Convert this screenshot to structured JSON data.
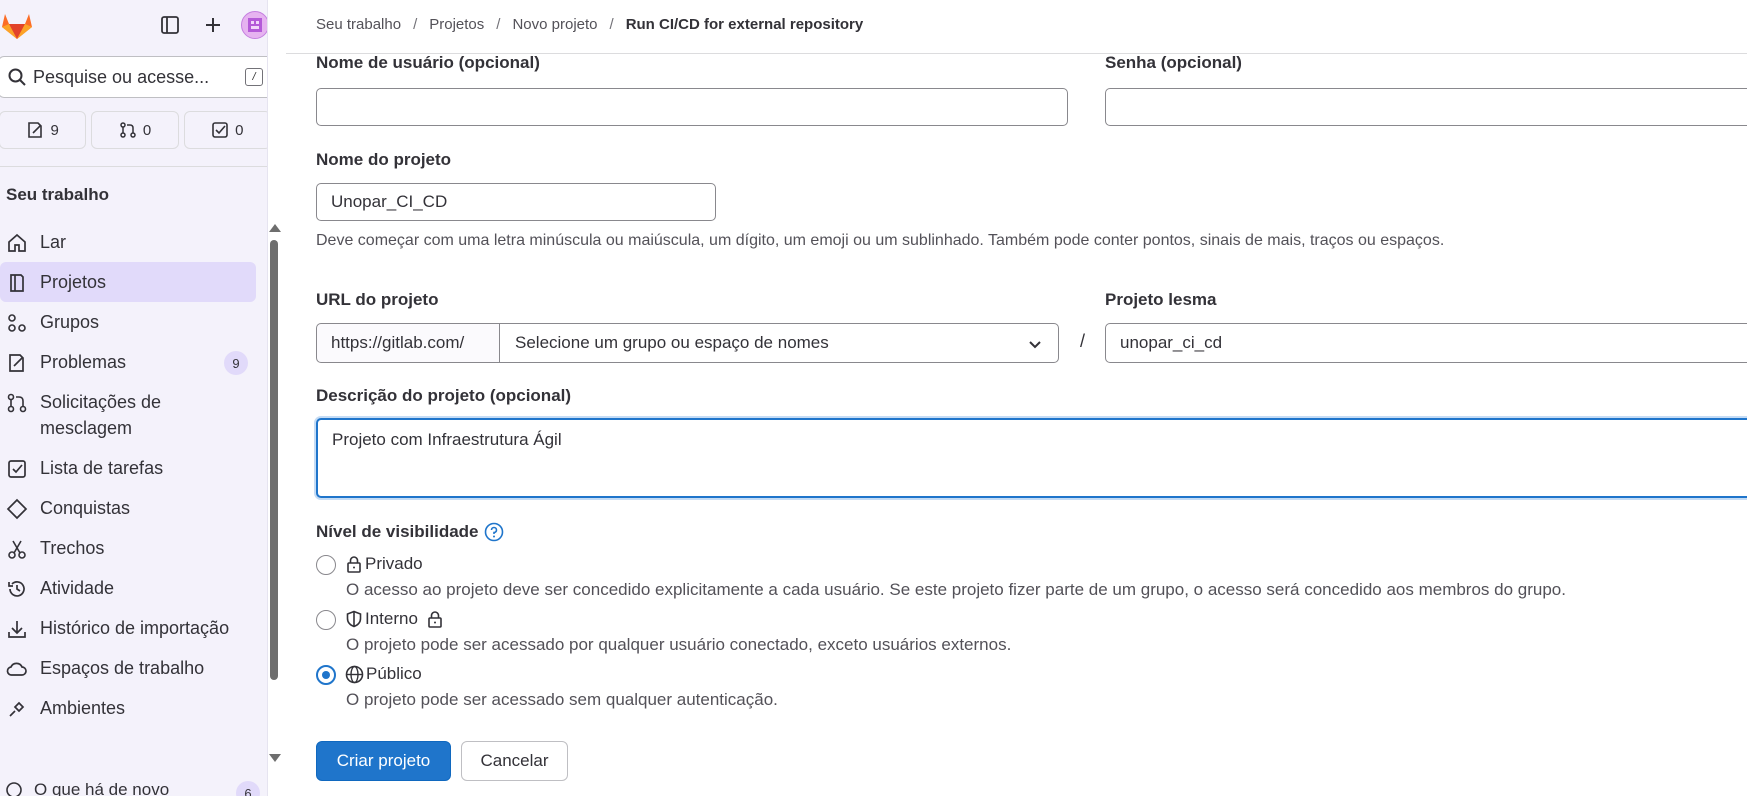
{
  "colors": {
    "accent": "#1f75cb",
    "sidebar_bg": "#f4f2fb",
    "active_nav": "#e1dafa",
    "logo_orange": "#e24329"
  },
  "sidebar": {
    "search_placeholder": "Pesquise ou acesse...",
    "search_shortcut": "/",
    "counts": [
      {
        "icon": "issues-icon",
        "value": "9"
      },
      {
        "icon": "merge-request-icon",
        "value": "0"
      },
      {
        "icon": "todo-icon",
        "value": "0"
      }
    ],
    "section_title": "Seu trabalho",
    "items": [
      {
        "label": "Lar",
        "icon": "home-icon"
      },
      {
        "label": "Projetos",
        "icon": "project-icon",
        "active": true
      },
      {
        "label": "Grupos",
        "icon": "group-icon"
      },
      {
        "label": "Problemas",
        "icon": "issues-icon",
        "badge": "9"
      },
      {
        "label": "Solicitações de mesclagem",
        "icon": "merge-request-icon"
      },
      {
        "label": "Lista de tarefas",
        "icon": "todo-icon"
      },
      {
        "label": "Conquistas",
        "icon": "achievement-icon"
      },
      {
        "label": "Trechos",
        "icon": "snippet-icon"
      },
      {
        "label": "Atividade",
        "icon": "history-icon"
      },
      {
        "label": "Histórico de importação",
        "icon": "import-icon"
      },
      {
        "label": "Espaços de trabalho",
        "icon": "workspace-icon"
      },
      {
        "label": "Ambientes",
        "icon": "environment-icon"
      }
    ],
    "whats_new": {
      "label": "O que há de novo",
      "badge": "6"
    }
  },
  "breadcrumb": {
    "items": [
      "Seu trabalho",
      "Projetos",
      "Novo projeto"
    ],
    "current": "Run CI/CD for external repository"
  },
  "form": {
    "username_label": "Nome de usuário (opcional)",
    "username_value": "",
    "password_label": "Senha (opcional)",
    "password_value": "",
    "project_name_label": "Nome do projeto",
    "project_name_value": "Unopar_CI_CD",
    "project_name_help": "Deve começar com uma letra minúscula ou maiúscula, um dígito, um emoji ou um sublinhado. Também pode conter pontos, sinais de mais, traços ou espaços.",
    "url_label": "URL do projeto",
    "url_prefix": "https://gitlab.com/",
    "namespace_placeholder": "Selecione um grupo ou espaço de nomes",
    "url_separator": "/",
    "slug_label": "Projeto lesma",
    "slug_value": "unopar_ci_cd",
    "description_label": "Descrição do projeto (opcional)",
    "description_value": "Projeto com Infraestrutura Ágil",
    "visibility_label": "Nível de visibilidade",
    "visibility": [
      {
        "label": "Privado",
        "description": "O acesso ao projeto deve ser concedido explicitamente a cada usuário. Se este projeto fizer parte de um grupo, o acesso será concedido aos membros do grupo.",
        "checked": false
      },
      {
        "label": "Interno",
        "description": "O projeto pode ser acessado por qualquer usuário conectado, exceto usuários externos.",
        "checked": false
      },
      {
        "label": "Público",
        "description": "O projeto pode ser acessado sem qualquer autenticação.",
        "checked": true
      }
    ],
    "create_button": "Criar projeto",
    "cancel_button": "Cancelar"
  }
}
